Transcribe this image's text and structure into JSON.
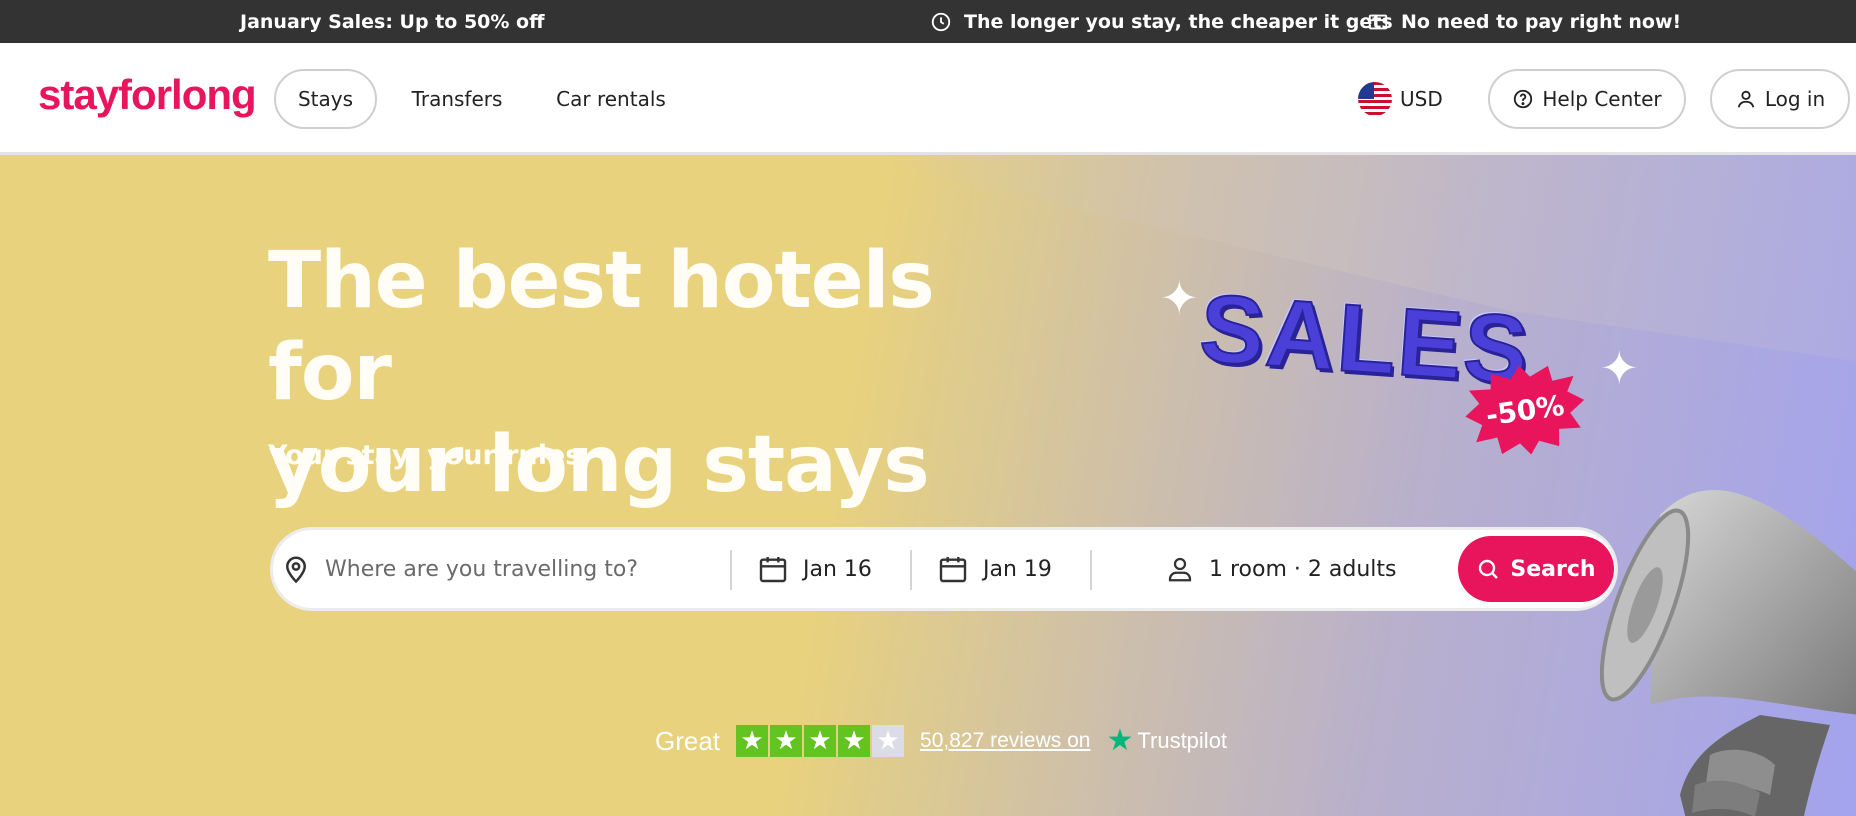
{
  "promo": {
    "sale_text": "January Sales: Up to 50% off",
    "longer_stay_text": "The longer you stay, the cheaper it gets",
    "no_pay_text": "No need to pay right now!"
  },
  "header": {
    "logo": "stayforlong",
    "nav": {
      "stays": "Stays",
      "transfers": "Transfers",
      "car_rentals": "Car rentals"
    },
    "currency": "USD",
    "help_center": "Help Center",
    "login": "Log in"
  },
  "hero": {
    "title_line1": "The best hotels for",
    "title_line2": "your long stays",
    "subtitle": "Your stay, your rules",
    "badge_text": "SALES",
    "badge_discount": "-50%"
  },
  "search": {
    "destination_placeholder": "Where are you travelling to?",
    "checkin": "Jan 16",
    "checkout": "Jan 19",
    "guests": "1 room · 2 adults",
    "button": "Search"
  },
  "trustpilot": {
    "rating_word": "Great",
    "stars_filled": 4,
    "stars_total": 5,
    "reviews_link": "50,827 reviews on",
    "brand": "Trustpilot"
  },
  "colors": {
    "brand": "#e8145c",
    "promo_bg": "#333333",
    "trustpilot_green": "#62c321"
  }
}
